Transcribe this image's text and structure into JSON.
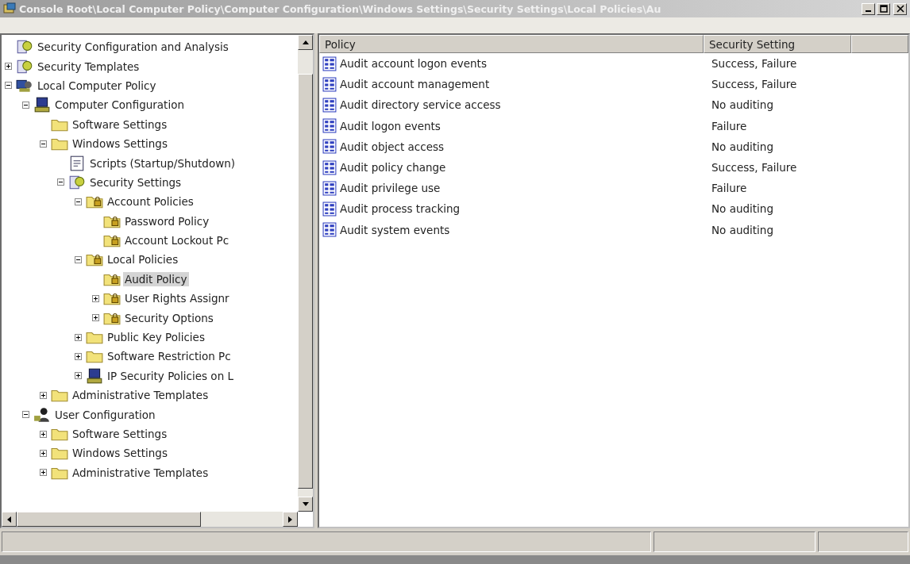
{
  "window": {
    "title": "Console Root\\Local Computer Policy\\Computer Configuration\\Windows Settings\\Security Settings\\Local Policies\\Au"
  },
  "tree": {
    "items": [
      {
        "label": "Security Configuration and Analysis",
        "kind": "snapin",
        "selected": false
      },
      {
        "label": "Security Templates",
        "kind": "snapin",
        "expanded": false,
        "selected": false
      },
      {
        "label": "Local Computer Policy",
        "kind": "policy",
        "expanded": true,
        "selected": false,
        "children": [
          {
            "label": "Computer Configuration",
            "kind": "computer",
            "expanded": true,
            "selected": false,
            "children": [
              {
                "label": "Software Settings",
                "kind": "folder",
                "selected": false
              },
              {
                "label": "Windows Settings",
                "kind": "folder",
                "expanded": true,
                "selected": false,
                "children": [
                  {
                    "label": "Scripts (Startup/Shutdown)",
                    "kind": "script",
                    "selected": false
                  },
                  {
                    "label": "Security Settings",
                    "kind": "snapin",
                    "expanded": true,
                    "selected": false,
                    "children": [
                      {
                        "label": "Account Policies",
                        "kind": "lockfolder",
                        "expanded": true,
                        "selected": false,
                        "children": [
                          {
                            "label": "Password Policy",
                            "kind": "lockfolder",
                            "selected": false
                          },
                          {
                            "label": "Account Lockout Pc",
                            "kind": "lockfolder",
                            "selected": false
                          }
                        ]
                      },
                      {
                        "label": "Local Policies",
                        "kind": "lockfolder",
                        "expanded": true,
                        "selected": false,
                        "children": [
                          {
                            "label": "Audit Policy",
                            "kind": "lockfolder",
                            "selected": true
                          },
                          {
                            "label": "User Rights Assignr",
                            "kind": "lockfolder",
                            "expanded": false,
                            "selected": false
                          },
                          {
                            "label": "Security Options",
                            "kind": "lockfolder",
                            "expanded": false,
                            "selected": false
                          }
                        ]
                      },
                      {
                        "label": "Public Key Policies",
                        "kind": "folder",
                        "expanded": false,
                        "selected": false
                      },
                      {
                        "label": "Software Restriction Pc",
                        "kind": "folder",
                        "expanded": false,
                        "selected": false
                      },
                      {
                        "label": "IP Security Policies on L",
                        "kind": "computer",
                        "expanded": false,
                        "selected": false
                      }
                    ]
                  }
                ]
              },
              {
                "label": "Administrative Templates",
                "kind": "folder",
                "expanded": false,
                "selected": false
              }
            ]
          },
          {
            "label": "User Configuration",
            "kind": "user",
            "expanded": true,
            "selected": false,
            "children": [
              {
                "label": "Software Settings",
                "kind": "folder",
                "expanded": false,
                "selected": false
              },
              {
                "label": "Windows Settings",
                "kind": "folder",
                "expanded": false,
                "selected": false
              },
              {
                "label": "Administrative Templates",
                "kind": "folder",
                "expanded": false,
                "selected": false
              }
            ]
          }
        ]
      }
    ]
  },
  "table": {
    "columns": [
      "Policy",
      "Security Setting"
    ],
    "rows": [
      {
        "policy": "Audit account logon events",
        "setting": "Success, Failure"
      },
      {
        "policy": "Audit account management",
        "setting": "Success, Failure"
      },
      {
        "policy": "Audit directory service access",
        "setting": "No auditing"
      },
      {
        "policy": "Audit logon events",
        "setting": "Failure"
      },
      {
        "policy": "Audit object access",
        "setting": "No auditing"
      },
      {
        "policy": "Audit policy change",
        "setting": "Success, Failure"
      },
      {
        "policy": "Audit privilege use",
        "setting": "Failure"
      },
      {
        "policy": "Audit process tracking",
        "setting": "No auditing"
      },
      {
        "policy": "Audit system events",
        "setting": "No auditing"
      }
    ]
  }
}
